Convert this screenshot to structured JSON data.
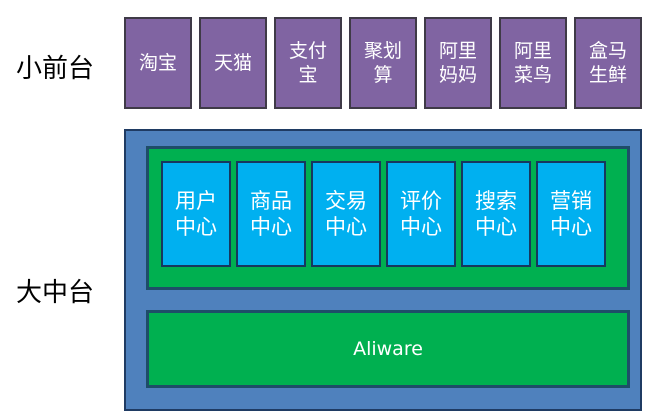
{
  "labels": {
    "small_front": "小前台",
    "big_middle": "大中台"
  },
  "front_apps": [
    "淘宝",
    "天猫",
    "支付宝",
    "聚划算",
    "阿里妈妈",
    "阿里菜鸟",
    "盒马生鲜"
  ],
  "middle": {
    "centers": [
      "用户中心",
      "商品中心",
      "交易中心",
      "评价中心",
      "搜索中心",
      "营销中心"
    ],
    "base": "Aliware"
  },
  "colors": {
    "front_fill": "#8064a2",
    "platform_fill": "#4f81bd",
    "layer_fill": "#00b050",
    "center_fill": "#00b0f0"
  }
}
